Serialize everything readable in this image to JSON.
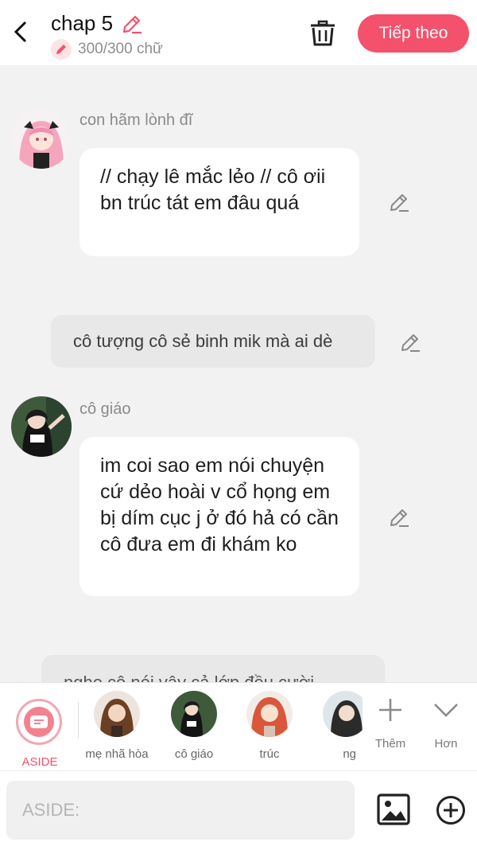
{
  "header": {
    "title": "chap 5",
    "char_count": "300/300 chữ",
    "next_button": "Tiếp theo"
  },
  "messages": [
    {
      "type": "character",
      "sender": "con hãm lònh đĩ",
      "text": "// chạy lê mắc lẻo // cô ơii bn trúc tát em đâu quá"
    },
    {
      "type": "aside",
      "text": "cô tượng cô sẻ binh mik mà ai dè"
    },
    {
      "type": "character",
      "sender": "cô giáo",
      "text": "im coi sao em nói chuyện cứ dẻo hoài v cổ họng em bị dím cục j ở đó hả có cần cô đưa em đi khám ko"
    },
    {
      "type": "aside",
      "text": "nghe cô nói vậy cả lớp đều cười"
    }
  ],
  "characters": [
    {
      "name": "ASIDE"
    },
    {
      "name": "mẹ nhã hòa"
    },
    {
      "name": "cô giáo"
    },
    {
      "name": "trúc"
    },
    {
      "name": "ng"
    }
  ],
  "tools": {
    "add_label": "Thêm",
    "more_label": "Hơn"
  },
  "input": {
    "placeholder": "ASIDE:",
    "value": ""
  },
  "colors": {
    "accent": "#f4516c",
    "background": "#f2f2f2",
    "bubble": "#ffffff",
    "aside_bubble": "#e8e8e8"
  }
}
